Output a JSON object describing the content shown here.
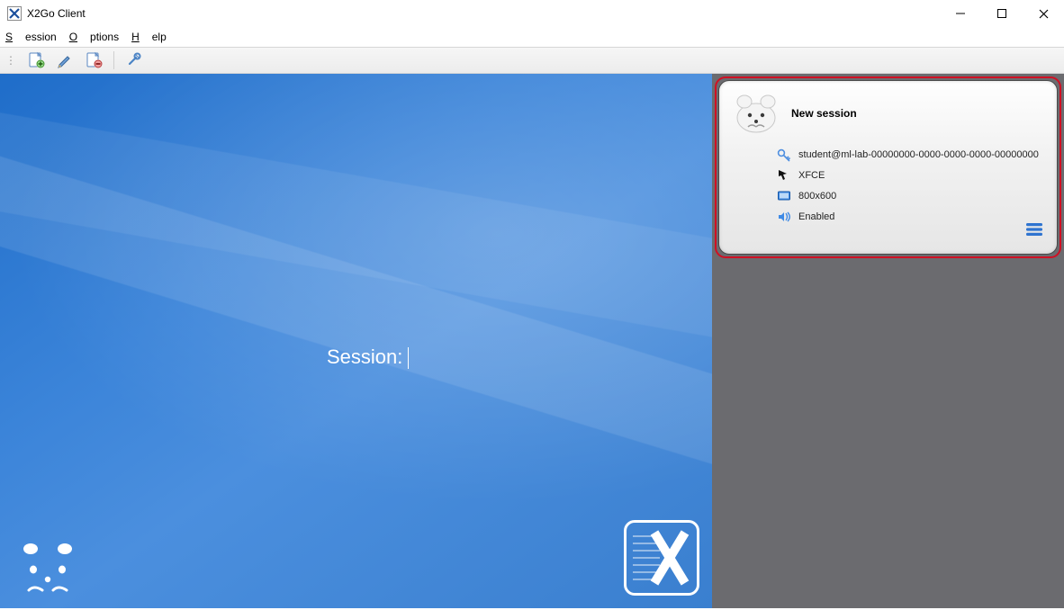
{
  "window": {
    "title": "X2Go Client"
  },
  "menu": {
    "session": "Session",
    "options": "Options",
    "help": "Help"
  },
  "toolbar": {
    "new_session": "new-session",
    "edit_session": "edit-session",
    "duplicate_session": "duplicate-session",
    "settings": "settings"
  },
  "main": {
    "session_label": "Session:"
  },
  "card": {
    "title": "New session",
    "connection": "student@ml-lab-00000000-0000-0000-0000-00000000",
    "desktop": "XFCE",
    "resolution": "800x600",
    "sound": "Enabled"
  },
  "colors": {
    "highlight": "#d01024",
    "accent": "#2f74d0"
  }
}
